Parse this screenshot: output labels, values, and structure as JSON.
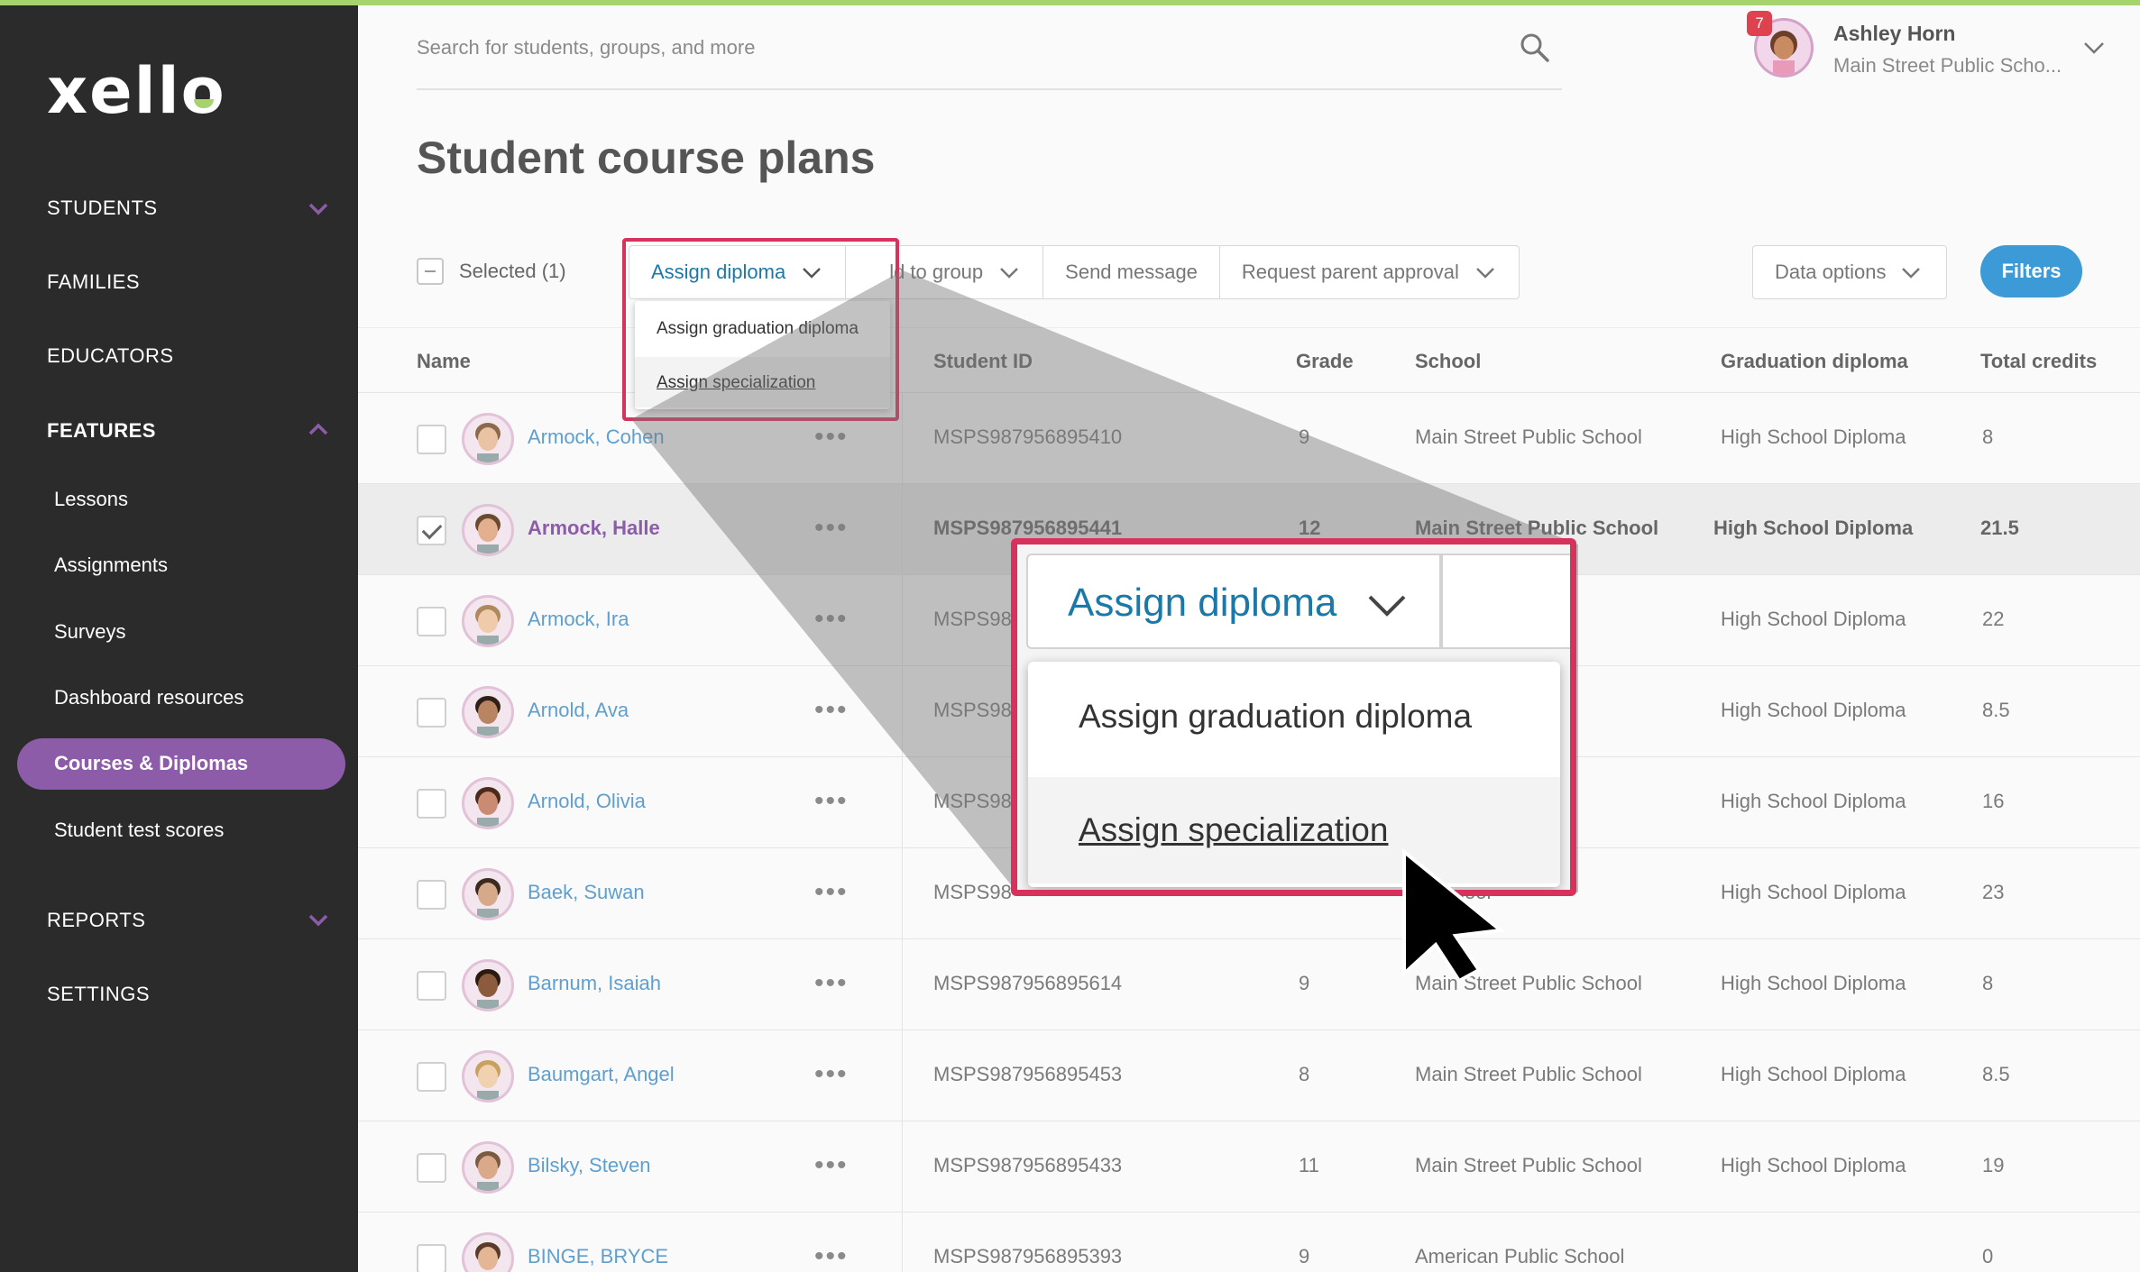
{
  "app": {
    "logo": "xello"
  },
  "sidebar": {
    "students": "STUDENTS",
    "families": "FAMILIES",
    "educators": "EDUCATORS",
    "features": "FEATURES",
    "features_items": [
      "Lessons",
      "Assignments",
      "Surveys",
      "Dashboard resources",
      "Courses & Diplomas",
      "Student test scores"
    ],
    "reports": "REPORTS",
    "settings": "SETTINGS"
  },
  "header": {
    "search_placeholder": "Search for students, groups, and more",
    "notification_count": "7",
    "user_name": "Ashley Horn",
    "user_school": "Main Street Public Scho..."
  },
  "page": {
    "title": "Student course plans"
  },
  "toolbar": {
    "selected": "Selected (1)",
    "assign_diploma": "Assign diploma",
    "add_to_group": "ld to group",
    "send_message": "Send message",
    "request_parent_approval": "Request parent approval",
    "data_options": "Data options",
    "filters": "Filters"
  },
  "dropdown": {
    "assign_graduation_diploma": "Assign graduation diploma",
    "assign_specialization": "Assign specialization"
  },
  "table": {
    "headers": [
      "Name",
      "Student ID",
      "Grade",
      "School",
      "Graduation diploma",
      "Total credits"
    ],
    "rows": [
      {
        "name": "Armock, Cohen",
        "id": "MSPS987956895410",
        "grade": "9",
        "school": "Main Street Public School",
        "diploma": "High School Diploma",
        "credits": "8",
        "selected": false
      },
      {
        "name": "Armock, Halle",
        "id": "MSPS987956895441",
        "grade": "12",
        "school": "Main Street Public School",
        "diploma": "High School Diploma",
        "credits": "21.5",
        "selected": true
      },
      {
        "name": "Armock, Ira",
        "id": "MSPS98",
        "grade": "",
        "school": "c School",
        "diploma": "High School Diploma",
        "credits": "22",
        "selected": false
      },
      {
        "name": "Arnold, Ava",
        "id": "MSPS98",
        "grade": "",
        "school": "c School",
        "diploma": "High School Diploma",
        "credits": "8.5",
        "selected": false
      },
      {
        "name": "Arnold, Olivia",
        "id": "MSPS98",
        "grade": "",
        "school": "c School",
        "diploma": "High School Diploma",
        "credits": "16",
        "selected": false
      },
      {
        "name": "Baek, Suwan",
        "id": "MSPS98",
        "grade": "",
        "school": "c School",
        "diploma": "High School Diploma",
        "credits": "23",
        "selected": false
      },
      {
        "name": "Barnum, Isaiah",
        "id": "MSPS987956895614",
        "grade": "9",
        "school": "Main Street Public School",
        "diploma": "High School Diploma",
        "credits": "8",
        "selected": false
      },
      {
        "name": "Baumgart, Angel",
        "id": "MSPS987956895453",
        "grade": "8",
        "school": "Main Street Public School",
        "diploma": "High School Diploma",
        "credits": "8.5",
        "selected": false
      },
      {
        "name": "Bilsky, Steven",
        "id": "MSPS987956895433",
        "grade": "11",
        "school": "Main Street Public School",
        "diploma": "High School Diploma",
        "credits": "19",
        "selected": false
      },
      {
        "name": "BINGE, BRYCE",
        "id": "MSPS987956895393",
        "grade": "9",
        "school": "American Public School",
        "diploma": "",
        "credits": "0",
        "selected": false
      }
    ]
  },
  "colors": {
    "accent_purple": "#8c5ca8",
    "link_blue": "#5f9fcf",
    "highlight_red": "#d7325b",
    "filters_blue": "#3c9ad6",
    "logo_green": "#a6d36b"
  }
}
